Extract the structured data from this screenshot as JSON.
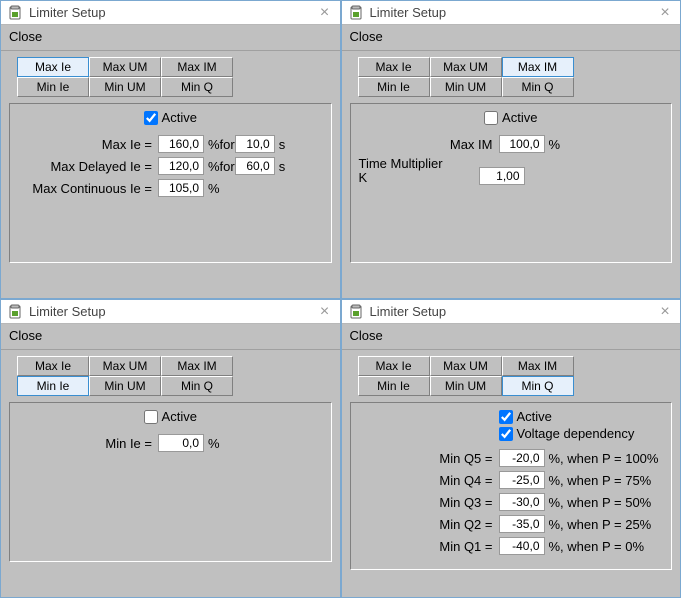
{
  "common": {
    "title": "Limiter Setup",
    "close_menu": "Close",
    "active_label": "Active",
    "voltage_dep_label": "Voltage dependency",
    "tab_labels": [
      "Max Ie",
      "Max UM",
      "Max IM",
      "Min Ie",
      "Min UM",
      "Min Q"
    ]
  },
  "panels": [
    {
      "active_tab": 0,
      "active_checked": true,
      "rows": [
        {
          "label": "Max Ie =",
          "v1": "160,0",
          "mid": "%for",
          "v2": "10,0",
          "tail": "s"
        },
        {
          "label": "Max Delayed Ie =",
          "v1": "120,0",
          "mid": "%for",
          "v2": "60,0",
          "tail": "s"
        },
        {
          "label": "Max Continuous Ie =",
          "v1": "105,0",
          "mid": "%"
        }
      ]
    },
    {
      "active_tab": 2,
      "active_checked": false,
      "rows": [
        {
          "label": "Max IM",
          "v1": "100,0",
          "mid": "%"
        },
        {
          "label": "Time Multiplier K",
          "v1": "1,00",
          "mid": "",
          "wide_label": true
        }
      ]
    },
    {
      "active_tab": 3,
      "active_checked": false,
      "rows": [
        {
          "label": "Min Ie =",
          "v1": "0,0",
          "mid": "%"
        }
      ]
    },
    {
      "active_tab": 5,
      "active_checked": true,
      "voltage_checked": true,
      "rows": [
        {
          "label": "Min Q5 =",
          "v1": "-20,0",
          "mid": "%, when P = 100%"
        },
        {
          "label": "Min Q4 =",
          "v1": "-25,0",
          "mid": "%, when P = 75%"
        },
        {
          "label": "Min Q3 =",
          "v1": "-30,0",
          "mid": "%, when P = 50%"
        },
        {
          "label": "Min Q2 =",
          "v1": "-35,0",
          "mid": "%, when P = 25%"
        },
        {
          "label": "Min Q1 =",
          "v1": "-40,0",
          "mid": "%, when P = 0%"
        }
      ]
    }
  ]
}
